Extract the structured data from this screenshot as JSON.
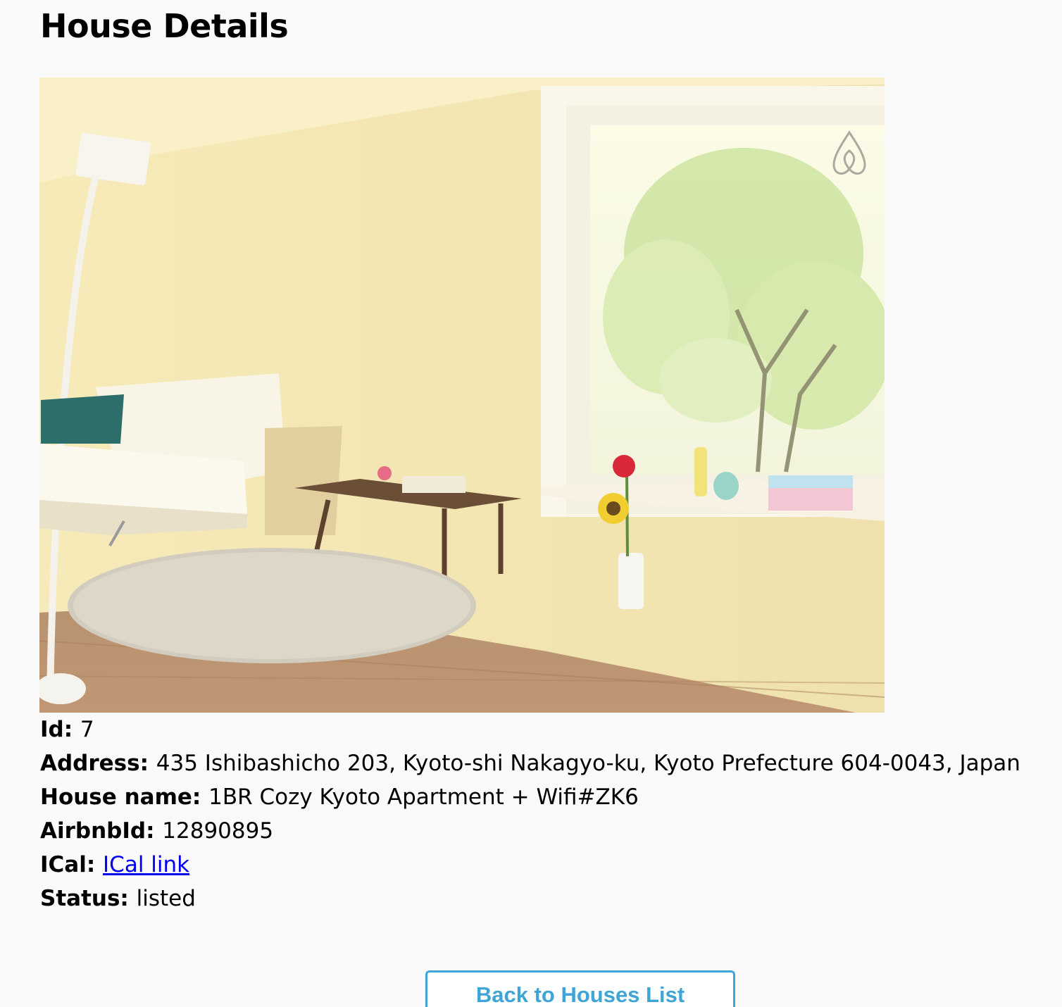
{
  "page": {
    "title": "House Details"
  },
  "photo": {
    "alt": "Living room with white sofa, round rug, wooden table and large window"
  },
  "details": {
    "id_label": "Id:",
    "id_value": "7",
    "address_label": "Address:",
    "address_value": "435 Ishibashicho 203, Kyoto-shi Nakagyo-ku, Kyoto Prefecture 604-0043, Japan",
    "house_name_label": "House name:",
    "house_name_value": "1BR Cozy Kyoto Apartment + Wifi#ZK6",
    "airbnb_label": "AirbnbId:",
    "airbnb_value": "12890895",
    "ical_label": "ICal:",
    "ical_link_text": "ICal link",
    "status_label": "Status:",
    "status_value": "listed"
  },
  "actions": {
    "back_label": "Back to Houses List"
  },
  "colors": {
    "link": "#0000ee",
    "button_accent": "#3fa5d6",
    "background": "#fafafa"
  },
  "icons": [
    "airbnb-logo-icon"
  ]
}
